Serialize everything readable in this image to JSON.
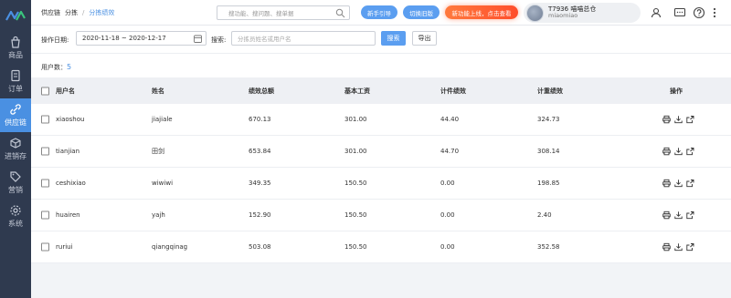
{
  "sidebar": {
    "items": [
      {
        "label": "商品",
        "icon": "bag-icon",
        "active": false
      },
      {
        "label": "订单",
        "icon": "document-icon",
        "active": false
      },
      {
        "label": "供应链",
        "icon": "link-icon",
        "active": true
      },
      {
        "label": "进销存",
        "icon": "inventory-icon",
        "active": false
      },
      {
        "label": "营销",
        "icon": "tag-icon",
        "active": false
      },
      {
        "label": "系统",
        "icon": "gear-icon",
        "active": false
      }
    ]
  },
  "header": {
    "breadcrumb": [
      "供应链",
      "分拣",
      "分拣绩效"
    ],
    "search_placeholder": "搜功能、搜问题、搜单据",
    "guide_button": "新手引导",
    "switch_button": "切换旧版",
    "new_feature_button": "新功能上线，点击查看",
    "user_name": "T7936 喵喵总仓",
    "user_sub": "miaomiao"
  },
  "filters": {
    "date_label": "操作日期:",
    "date_value": "2020-11-18 ~ 2020-12-17",
    "keyword_label": "搜索:",
    "keyword_placeholder": "分拣员姓名或用户名",
    "search_button": "搜索",
    "export_button": "导出"
  },
  "summary": {
    "user_count_label": "用户数：",
    "user_count": "5"
  },
  "table": {
    "columns": [
      "用户名",
      "姓名",
      "绩效总额",
      "基本工资",
      "计件绩效",
      "计重绩效",
      "操作"
    ],
    "rows": [
      [
        "xiaoshou",
        "jiajiale",
        "670.13",
        "301.00",
        "44.40",
        "324.73"
      ],
      [
        "tianjian",
        "田剑",
        "653.84",
        "301.00",
        "44.70",
        "308.14"
      ],
      [
        "ceshixiao",
        "wiwiwi",
        "349.35",
        "150.50",
        "0.00",
        "198.85"
      ],
      [
        "huairen",
        "yajh",
        "152.90",
        "150.50",
        "0.00",
        "2.40"
      ],
      [
        "ruriui",
        "qiangqinag",
        "503.08",
        "150.50",
        "0.00",
        "352.58"
      ]
    ]
  },
  "colors": {
    "sidebar_bg": "#2f3a4f",
    "accent": "#4a90e2",
    "orange": "#ff5a2e"
  }
}
